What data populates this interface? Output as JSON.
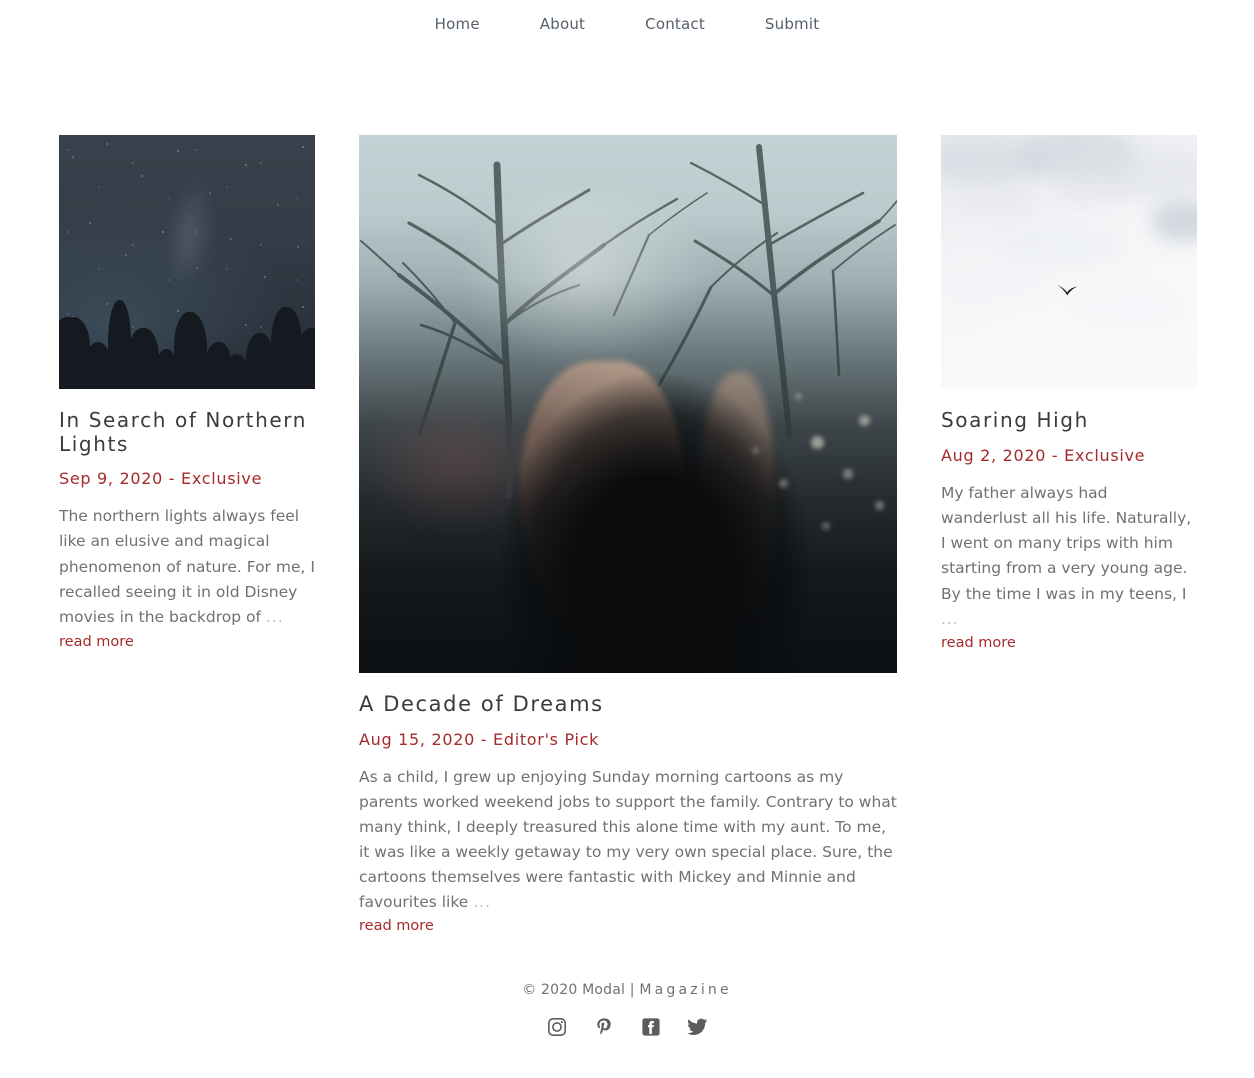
{
  "nav": {
    "items": [
      {
        "label": "Home"
      },
      {
        "label": "About"
      },
      {
        "label": "Contact"
      },
      {
        "label": "Submit"
      }
    ]
  },
  "articles": {
    "left": {
      "image_alt": "starry-night-sky-over-treeline",
      "title": "In Search of Northern Lights",
      "meta": "Sep 9, 2020 - Exclusive",
      "body": "The northern lights always feel like an elusive and magical phenomenon of nature. For me, I recalled seeing it in old Disney movies in the backdrop of",
      "ellipsis": "...",
      "read_more": "read more"
    },
    "center": {
      "image_alt": "woman-backlit-in-winter-forest",
      "title": "A Decade of Dreams",
      "meta": "Aug 15, 2020 - Editor's Pick",
      "body": "As a child, I grew up enjoying Sunday morning cartoons as my parents worked weekend jobs to support the family. Contrary to what many think, I deeply treasured this alone time with my aunt. To me, it was like a weekly getaway to my very own special place. Sure, the cartoons themselves were fantastic with Mickey and Minnie and favourites like",
      "ellipsis": "...",
      "read_more": "read more"
    },
    "right": {
      "image_alt": "bird-soaring-against-white-clouds",
      "title": "Soaring High",
      "meta": "Aug 2, 2020 - Exclusive",
      "body": "My father always had wanderlust all his life. Naturally, I went on many trips with him starting from a very young age. By the time I was in my teens, I",
      "ellipsis": "...",
      "read_more": "read more"
    }
  },
  "footer": {
    "copyright_prefix": "© 2020 Modal | ",
    "copyright_brand": "Magazine",
    "social": [
      {
        "name": "instagram-icon",
        "label": "Instagram"
      },
      {
        "name": "pinterest-icon",
        "label": "Pinterest"
      },
      {
        "name": "facebook-icon",
        "label": "Facebook"
      },
      {
        "name": "twitter-icon",
        "label": "Twitter"
      }
    ]
  },
  "colors": {
    "accent_red": "#a52a2a",
    "title_gray": "#3b3b3b",
    "body_gray": "#6e7276",
    "nav_gray": "#55606b",
    "background": "#ffffff"
  }
}
